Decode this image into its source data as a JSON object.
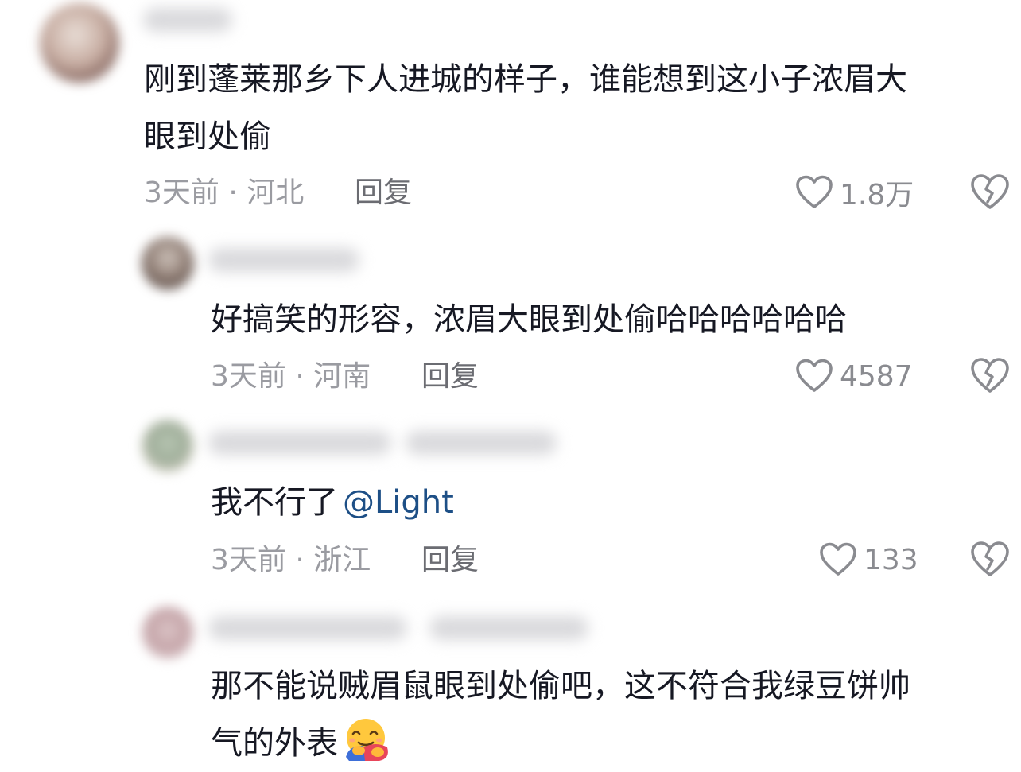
{
  "comments": [
    {
      "text_line1": "刚到蓬莱那乡下人进城的样子，谁能想到这小子浓眉大",
      "text_line2": "眼到处偷",
      "time": "3天前",
      "location": "河北",
      "reply_label": "回复",
      "likes": "1.8万"
    },
    {
      "text_line1": "好搞笑的形容，浓眉大眼到处偷哈哈哈哈哈哈",
      "time": "3天前",
      "location": "河南",
      "reply_label": "回复",
      "likes": "4587"
    },
    {
      "text_prefix": "我不行了",
      "mention": "@Light",
      "time": "3天前",
      "location": "浙江",
      "reply_label": "回复",
      "likes": "133"
    },
    {
      "text_line1": "那不能说贼眉鼠眼到处偷吧，这不符合我绿豆饼帅",
      "text_line2": "气的外表",
      "emoji": "hug-emoji"
    }
  ],
  "meta_separator": " · ",
  "colors": {
    "text": "#161823",
    "meta": "#9a9ba1",
    "mention": "#1d4f86",
    "icon": "#8a8b90"
  },
  "icons": {
    "like": "heart-outline-icon",
    "dislike": "broken-heart-icon"
  }
}
